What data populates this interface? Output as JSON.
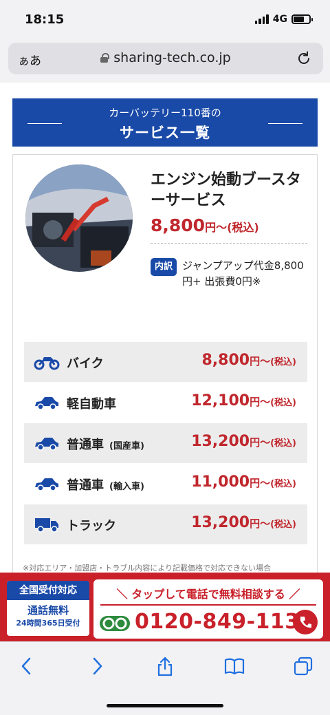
{
  "status_bar": {
    "time": "18:15",
    "network": "4G"
  },
  "browser": {
    "aa_label": "ぁあ",
    "url": "sharing-tech.co.jp"
  },
  "header": {
    "subtitle": "カーバッテリー110番の",
    "title": "サービス一覧"
  },
  "service": {
    "title": "エンジン始動ブースターサービス",
    "price": "8,800",
    "price_unit": "円〜(税込)",
    "badge": "内訳",
    "breakdown": "ジャンプアップ代金8,800円+ 出張費0円※"
  },
  "price_list": [
    {
      "icon": "motorcycle-icon",
      "label": "バイク",
      "note": "",
      "price": "8,800",
      "unit": "円〜",
      "tax": "(税込)"
    },
    {
      "icon": "car-icon",
      "label": "軽自動車",
      "note": "",
      "price": "12,100",
      "unit": "円〜",
      "tax": "(税込)"
    },
    {
      "icon": "car-icon",
      "label": "普通車",
      "note": "(国産車)",
      "price": "13,200",
      "unit": "円〜",
      "tax": "(税込)"
    },
    {
      "icon": "car-icon",
      "label": "普通車",
      "note": "(輸入車)",
      "price": "11,000",
      "unit": "円〜",
      "tax": "(税込)"
    },
    {
      "icon": "truck-icon",
      "label": "トラック",
      "note": "",
      "price": "13,200",
      "unit": "円〜",
      "tax": "(税込)"
    }
  ],
  "footnote": "※対応エリア・加盟店・トラブル内容により記載価格で対応できない場合",
  "cta": {
    "nationwide": "全国受付対応",
    "free_call": "通話無料",
    "hours": "24時間365日受付",
    "tap_text": "＼ タップして電話で無料相談する ／",
    "phone": "0120-849-113"
  },
  "colors": {
    "brand_blue": "#1a4aa8",
    "price_red": "#c0272d",
    "cta_red": "#c9202a"
  }
}
